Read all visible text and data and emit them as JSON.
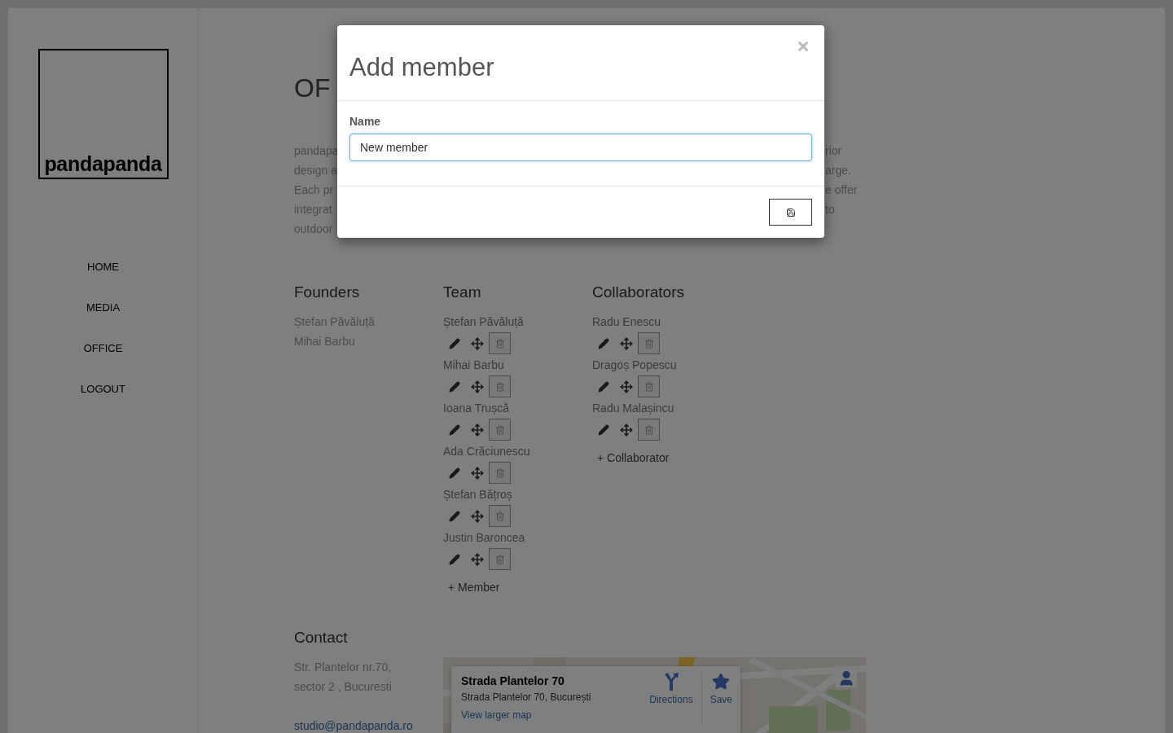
{
  "sidebar": {
    "logo": "pandapanda",
    "nav": [
      "HOME",
      "MEDIA",
      "OFFICE",
      "LOGOUT"
    ]
  },
  "page": {
    "heading": "OF",
    "intro_lines": [
      {
        "start": "pandapa",
        "end": "rior"
      },
      {
        "start": "design a",
        "end": "arge."
      },
      {
        "start": "Each pr",
        "end": "e offer"
      },
      {
        "start": "integrat",
        "end": "to"
      },
      {
        "start": "outdoor"
      }
    ]
  },
  "founders": {
    "title": "Founders",
    "names": [
      "Ștefan Păvăluță",
      "Mihai Barbu"
    ]
  },
  "team": {
    "title": "Team",
    "members": [
      "Ștefan Păvăluță",
      "Mihai Barbu",
      "Ioana Trușcă",
      "Ada Crăciunescu",
      "Ștefan Bățroș",
      "Justin Baroncea"
    ],
    "add": "+ Member"
  },
  "collaborators": {
    "title": "Collaborators",
    "members": [
      "Radu Enescu",
      "Dragoș Popescu",
      "Radu Malașincu"
    ],
    "add": "+ Collaborator"
  },
  "contact": {
    "title": "Contact",
    "address_lines": [
      "Str. Plantelor nr.70,",
      "sector 2 , Bucuresti"
    ],
    "email": "studio@pandapanda.ro"
  },
  "map": {
    "place": "Strada Plantelor 70",
    "address": "Strada Plantelor 70, București",
    "directions": "Directions",
    "save": "Save",
    "larger_map": "View larger map"
  },
  "modal": {
    "title": "Add member",
    "field_label": "Name",
    "field_value": "New member"
  }
}
